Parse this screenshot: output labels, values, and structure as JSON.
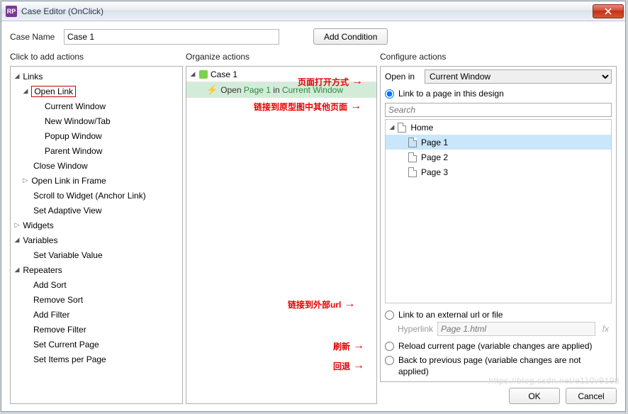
{
  "window": {
    "title": "Case Editor (OnClick)"
  },
  "caseName": {
    "label": "Case Name",
    "value": "Case 1"
  },
  "addCondition": "Add Condition",
  "headers": {
    "actions": "Click to add actions",
    "organize": "Organize actions",
    "configure": "Configure actions"
  },
  "actionsTree": {
    "links": "Links",
    "openLink": "Open Link",
    "currentWindow": "Current Window",
    "newWindow": "New Window/Tab",
    "popupWindow": "Popup Window",
    "parentWindow": "Parent Window",
    "closeWindow": "Close Window",
    "openFrame": "Open Link in Frame",
    "scrollWidget": "Scroll to Widget (Anchor Link)",
    "setAdaptive": "Set Adaptive View",
    "widgets": "Widgets",
    "variables": "Variables",
    "setVarValue": "Set Variable Value",
    "repeaters": "Repeaters",
    "addSort": "Add Sort",
    "removeSort": "Remove Sort",
    "addFilter": "Add Filter",
    "removeFilter": "Remove Filter",
    "setCurrentPage": "Set Current Page",
    "setItemsPerPage": "Set Items per Page"
  },
  "organize": {
    "caseLabel": "Case 1",
    "action_open": "Open",
    "action_page": "Page 1",
    "action_in": "in",
    "action_cw": "Current Window"
  },
  "configure": {
    "openInLabel": "Open in",
    "openInValue": "Current Window",
    "radioLinkDesign": "Link to a page in this design",
    "searchPlaceholder": "Search",
    "home": "Home",
    "page1": "Page 1",
    "page2": "Page 2",
    "page3": "Page 3",
    "radioExternal": "Link to an external url or file",
    "hyperlinkLabel": "Hyperlink",
    "hyperlinkValue": "Page 1.html",
    "fx": "fx",
    "radioReload": "Reload current page (variable changes are applied)",
    "radioBack": "Back to previous page (variable changes are not applied)"
  },
  "footer": {
    "ok": "OK",
    "cancel": "Cancel"
  },
  "annotations": {
    "openMethod": "页面打开方式",
    "linkOther": "链接到原型图中其他页面",
    "external": "链接到外部url",
    "refresh": "刷新",
    "back": "回退"
  },
  "watermark": "https://blog.csdn.net/e110v9198"
}
